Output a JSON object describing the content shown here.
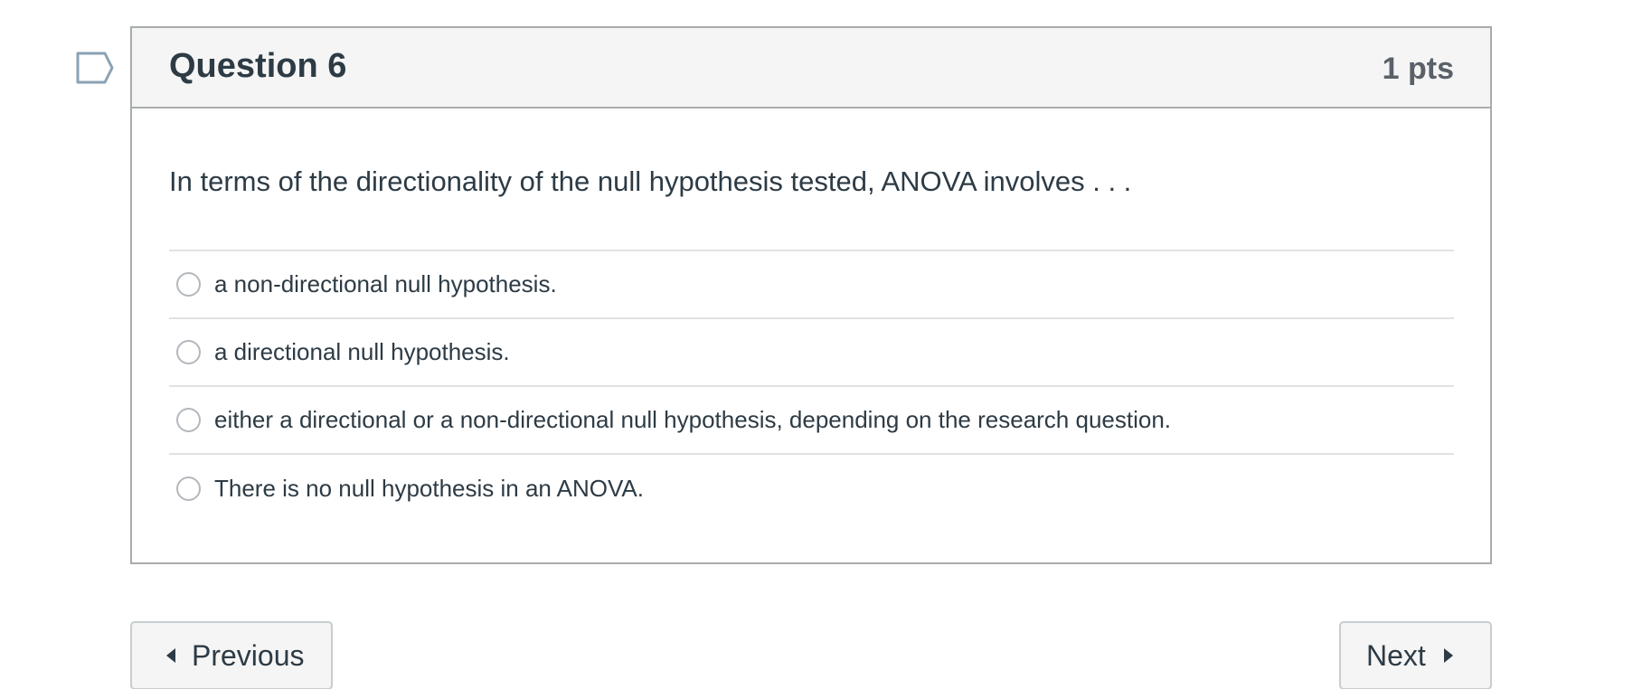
{
  "question": {
    "title": "Question 6",
    "points": "1 pts",
    "text": "In terms of the directionality of the null hypothesis tested, ANOVA involves . . .",
    "answers": [
      {
        "label": "a non-directional null hypothesis.",
        "selected": false
      },
      {
        "label": "a directional null hypothesis.",
        "selected": false
      },
      {
        "label": "either a directional or a non-directional null hypothesis, depending on the research question.",
        "selected": false
      },
      {
        "label": "There is no null hypothesis in an ANOVA.",
        "selected": false
      }
    ]
  },
  "flag": {
    "icon": "flag-icon",
    "color": "#8aa2b5"
  },
  "navigation": {
    "previous_label": "Previous",
    "next_label": "Next"
  }
}
